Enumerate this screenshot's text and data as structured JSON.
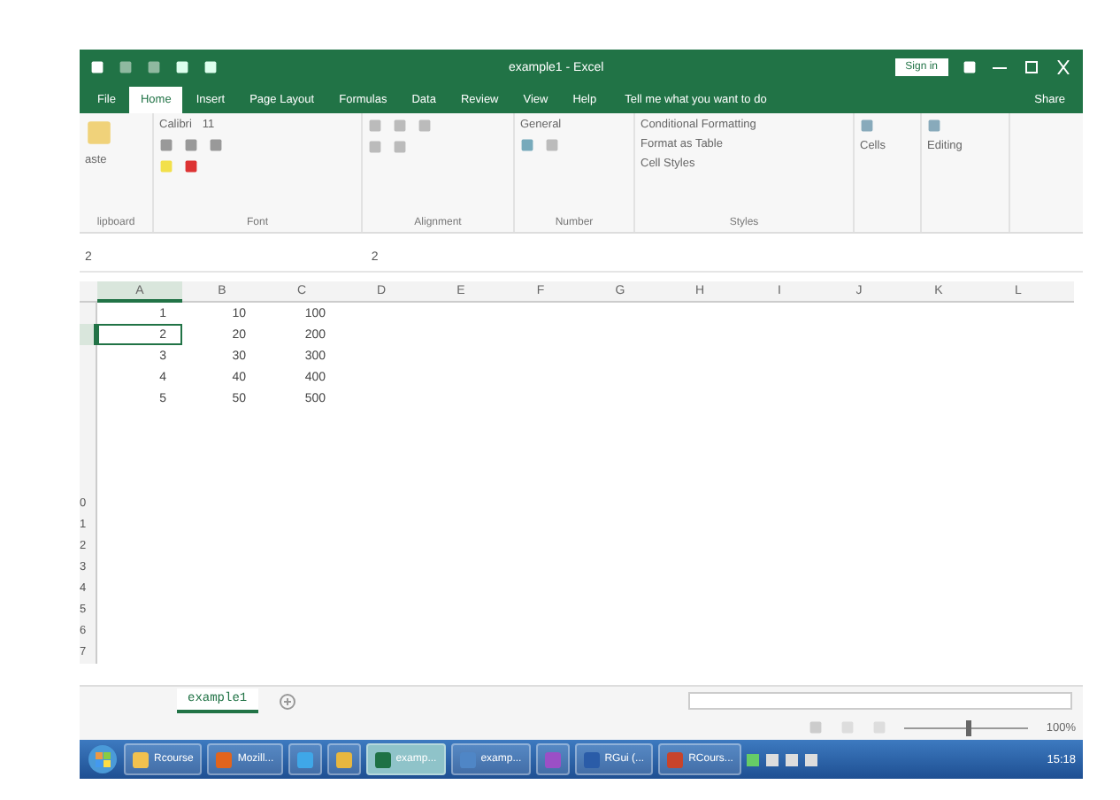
{
  "window": {
    "title": "example1 - Excel",
    "sign_in": "Sign in"
  },
  "tabs": [
    {
      "label": "File",
      "selected": false
    },
    {
      "label": "Home",
      "selected": true
    },
    {
      "label": "Insert",
      "selected": false
    },
    {
      "label": "Page Layout",
      "selected": false
    },
    {
      "label": "Formulas",
      "selected": false
    },
    {
      "label": "Data",
      "selected": false
    },
    {
      "label": "Review",
      "selected": false
    },
    {
      "label": "View",
      "selected": false
    },
    {
      "label": "Help",
      "selected": false
    }
  ],
  "tell_me": "Tell me what you want to do",
  "share": "Share",
  "ribbon": {
    "paste": "aste",
    "font_name": "Calibri",
    "font_size": "11",
    "number_format": "General",
    "styles": [
      "Conditional Formatting",
      "Format as Table",
      "Cell Styles"
    ],
    "cells": "Cells",
    "editing": "Editing",
    "groups": [
      "lipboard",
      "Font",
      "Alignment",
      "Number",
      "Styles"
    ]
  },
  "name_box": "2",
  "formula": "2",
  "columns": [
    {
      "label": "A",
      "selected": true
    },
    {
      "label": "B",
      "selected": false
    },
    {
      "label": "C",
      "selected": false
    },
    {
      "label": "D",
      "selected": false
    },
    {
      "label": "E",
      "selected": false
    },
    {
      "label": "F",
      "selected": false
    },
    {
      "label": "G",
      "selected": false
    },
    {
      "label": "H",
      "selected": false
    },
    {
      "label": "I",
      "selected": false
    },
    {
      "label": "J",
      "selected": false
    },
    {
      "label": "K",
      "selected": false
    },
    {
      "label": "L",
      "selected": false
    }
  ],
  "rows": [
    {
      "cells": [
        "1",
        "10",
        "100"
      ],
      "selected": false
    },
    {
      "cells": [
        "2",
        "20",
        "200"
      ],
      "selected": true
    },
    {
      "cells": [
        "3",
        "30",
        "300"
      ],
      "selected": false
    },
    {
      "cells": [
        "4",
        "40",
        "400"
      ],
      "selected": false
    },
    {
      "cells": [
        "5",
        "50",
        "500"
      ],
      "selected": false
    },
    {
      "selected": false
    },
    {
      "selected": false
    },
    {
      "selected": false
    },
    {
      "selected": false
    },
    {
      "header": "0",
      "selected": false
    },
    {
      "header": "1",
      "selected": false
    },
    {
      "header": "2",
      "selected": false
    },
    {
      "header": "3",
      "selected": false
    },
    {
      "header": "4",
      "selected": false
    },
    {
      "header": "5",
      "selected": false
    },
    {
      "header": "6",
      "selected": false
    },
    {
      "header": "7",
      "selected": false
    }
  ],
  "sheets": [
    {
      "label": "example1",
      "selected": true
    }
  ],
  "zoom": "100%",
  "zoom_slider": {
    "level": 0.5
  },
  "taskbar": {
    "items": [
      {
        "kind": "folder",
        "label": "Rcourse",
        "active": false
      },
      {
        "kind": "firefox",
        "label": "Mozill...",
        "active": false
      },
      {
        "kind": "ie",
        "active": false
      },
      {
        "kind": "chrome",
        "active": false
      },
      {
        "kind": "excel",
        "label": "examp...",
        "active": true
      },
      {
        "kind": "doc",
        "label": "examp...",
        "active": false
      },
      {
        "kind": "app",
        "active": false
      },
      {
        "kind": "rgui",
        "label": "RGui (...",
        "active": false
      },
      {
        "kind": "ppt",
        "label": "RCours...",
        "active": false
      }
    ],
    "time": "15:18"
  }
}
